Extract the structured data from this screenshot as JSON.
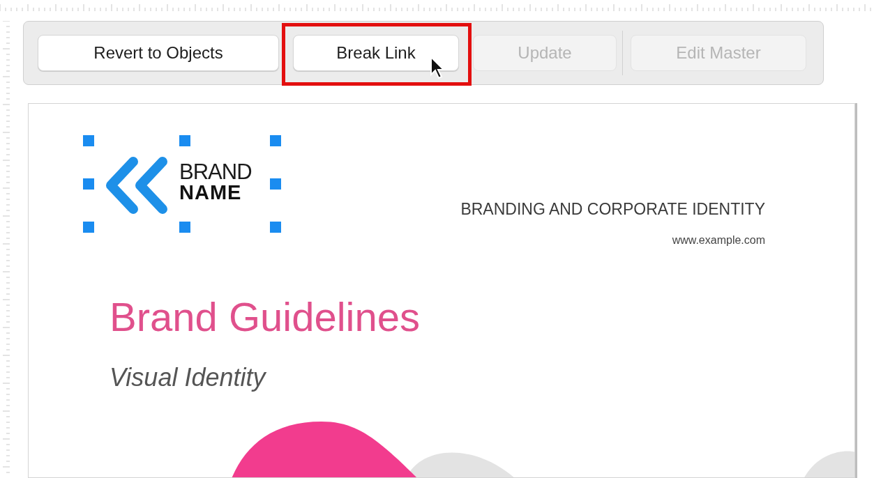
{
  "toolbar": {
    "buttons": [
      {
        "label": "Revert to Objects",
        "disabled": false,
        "highlighted": false,
        "hovered": false
      },
      {
        "label": "Break Link",
        "disabled": false,
        "highlighted": true,
        "hovered": true
      },
      {
        "label": "Update",
        "disabled": true,
        "highlighted": false,
        "hovered": false
      },
      {
        "label": "Edit Master",
        "disabled": true,
        "highlighted": false,
        "hovered": false
      }
    ]
  },
  "document": {
    "logo": {
      "line_1": "BRAND",
      "line_2": "NAME",
      "selected": true
    },
    "tagline": "BRANDING AND CORPORATE IDENTITY",
    "website": "www.example.com",
    "title": "Brand Guidelines",
    "subtitle": "Visual Identity"
  }
}
